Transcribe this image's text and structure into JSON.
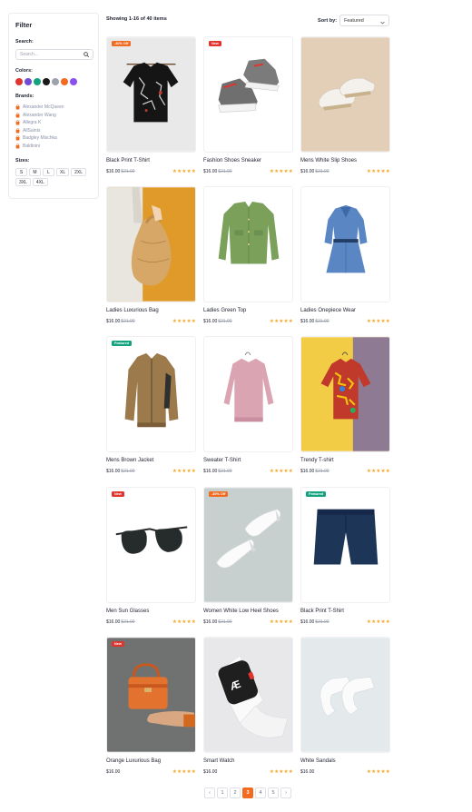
{
  "filter": {
    "title": "Filter",
    "search_label": "Search:",
    "search_placeholder": "Search...",
    "colors_label": "Colors:",
    "colors": [
      "#e0342e",
      "#6f4bd8",
      "#13a37f",
      "#1a1a1a",
      "#9da3ad",
      "#f26b21",
      "#8a4ff0"
    ],
    "brands_label": "Brands:",
    "brands": [
      "Alexander McQueen",
      "Alexander Wang",
      "Allegra K",
      "AllSaints",
      "Badgley Mischka",
      "Baldinini"
    ],
    "sizes_label": "Sizes:",
    "sizes": [
      "S",
      "M",
      "L",
      "XL",
      "2XL",
      "3XL",
      "4XL"
    ]
  },
  "toolbar": {
    "results": "Showing 1-16 of 40 items",
    "sort_label": "Sort by:",
    "sort_value": "Featured"
  },
  "colors": {
    "accent": "#f26b21",
    "new_badge": "#e0342e",
    "featured_badge": "#13a37f",
    "star": "#f5a623"
  },
  "products": [
    {
      "name": "Black Print T-Shirt",
      "price": "$16.00",
      "old_price": "$21.00",
      "stars": "★★★★★",
      "badge": "-40% Off",
      "badge_color": "#f26b21"
    },
    {
      "name": "Fashion Shoes Sneaker",
      "price": "$16.00",
      "old_price": "$21.00",
      "stars": "★★★★★",
      "badge": "New",
      "badge_color": "#e0342e"
    },
    {
      "name": "Mens White Slip Shoes",
      "price": "$16.00",
      "old_price": "$21.00",
      "stars": "★★★★★",
      "badge": "",
      "badge_color": ""
    },
    {
      "name": "Ladies Luxurious Bag",
      "price": "$16.00",
      "old_price": "$21.00",
      "stars": "★★★★★",
      "badge": "",
      "badge_color": ""
    },
    {
      "name": "Ladies Green Top",
      "price": "$16.00",
      "old_price": "$21.00",
      "stars": "★★★★★",
      "badge": "",
      "badge_color": ""
    },
    {
      "name": "Ladies Onepiece Wear",
      "price": "$16.00",
      "old_price": "$21.00",
      "stars": "★★★★★",
      "badge": "",
      "badge_color": ""
    },
    {
      "name": "Mens Brown Jacket",
      "price": "$16.00",
      "old_price": "$21.00",
      "stars": "★★★★★",
      "badge": "Featured",
      "badge_color": "#13a37f"
    },
    {
      "name": "Sweater T-Shirt",
      "price": "$16.00",
      "old_price": "$21.00",
      "stars": "★★★★★",
      "badge": "",
      "badge_color": ""
    },
    {
      "name": "Trendy T-shirt",
      "price": "$16.00",
      "old_price": "$21.00",
      "stars": "★★★★★",
      "badge": "",
      "badge_color": ""
    },
    {
      "name": "Men Sun Glasses",
      "price": "$16.00",
      "old_price": "$21.00",
      "stars": "★★★★★",
      "badge": "New",
      "badge_color": "#e0342e"
    },
    {
      "name": "Women White Low Heel Shoes",
      "price": "$16.00",
      "old_price": "$21.00",
      "stars": "★★★★★",
      "badge": "-30% Off",
      "badge_color": "#f26b21"
    },
    {
      "name": "Black Print T-Shirt",
      "price": "$16.00",
      "old_price": "$21.00",
      "stars": "★★★★★",
      "badge": "Featured",
      "badge_color": "#13a37f"
    },
    {
      "name": "Orange Luxurious Bag",
      "price": "$16.00",
      "old_price": "",
      "stars": "★★★★★",
      "badge": "New",
      "badge_color": "#e0342e"
    },
    {
      "name": "Smart Watch",
      "price": "$16.00",
      "old_price": "",
      "stars": "★★★★★",
      "badge": "",
      "badge_color": ""
    },
    {
      "name": "White Sandals",
      "price": "$16.00",
      "old_price": "",
      "stars": "★★★★★",
      "badge": "",
      "badge_color": ""
    }
  ],
  "pagination": {
    "prev": "‹",
    "pages": [
      "1",
      "2",
      "3",
      "4",
      "5"
    ],
    "current": "3",
    "next": "›"
  }
}
